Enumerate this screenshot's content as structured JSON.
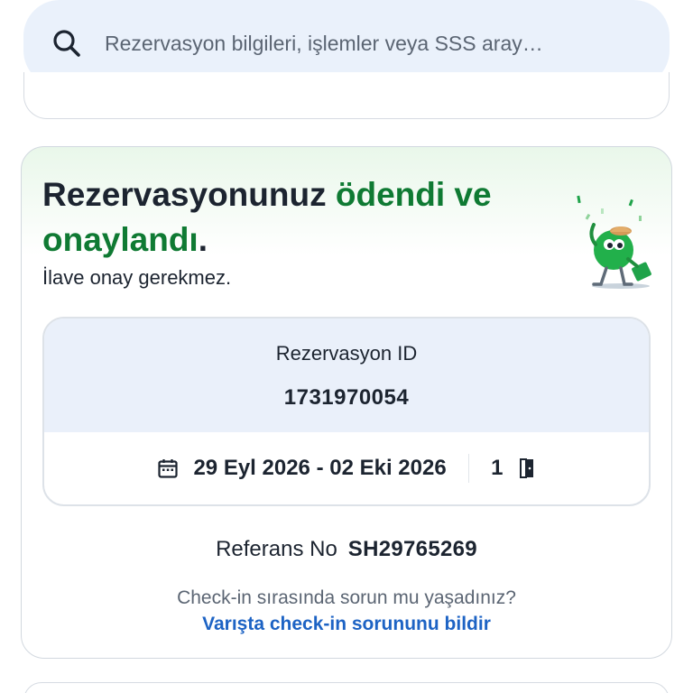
{
  "search": {
    "placeholder": "Rezervasyon bilgileri, işlemler veya SSS aray…",
    "icon": "search-icon"
  },
  "status_card": {
    "headline_part1": "Rezervasyonunuz ",
    "headline_part2": "ödendi ve onaylandı",
    "headline_part3": ".",
    "subline": "İlave onay gerekmez.",
    "accent_color": "#0f7a33",
    "mascot_icon": "celebrating-traveler-mascot"
  },
  "booking": {
    "id_label": "Rezervasyon ID",
    "id_value": "1731970054",
    "dates": "29 Eyl 2026 - 02 Eki 2026",
    "rooms": "1",
    "calendar_icon": "calendar-icon",
    "room_icon": "door-icon"
  },
  "reference": {
    "label": "Referans No",
    "value": "SH29765269"
  },
  "checkin_help": {
    "question": "Check-in sırasında sorun mu yaşadınız?",
    "link": "Varışta check-in sorununu bildir",
    "link_color": "#1d63c4"
  }
}
